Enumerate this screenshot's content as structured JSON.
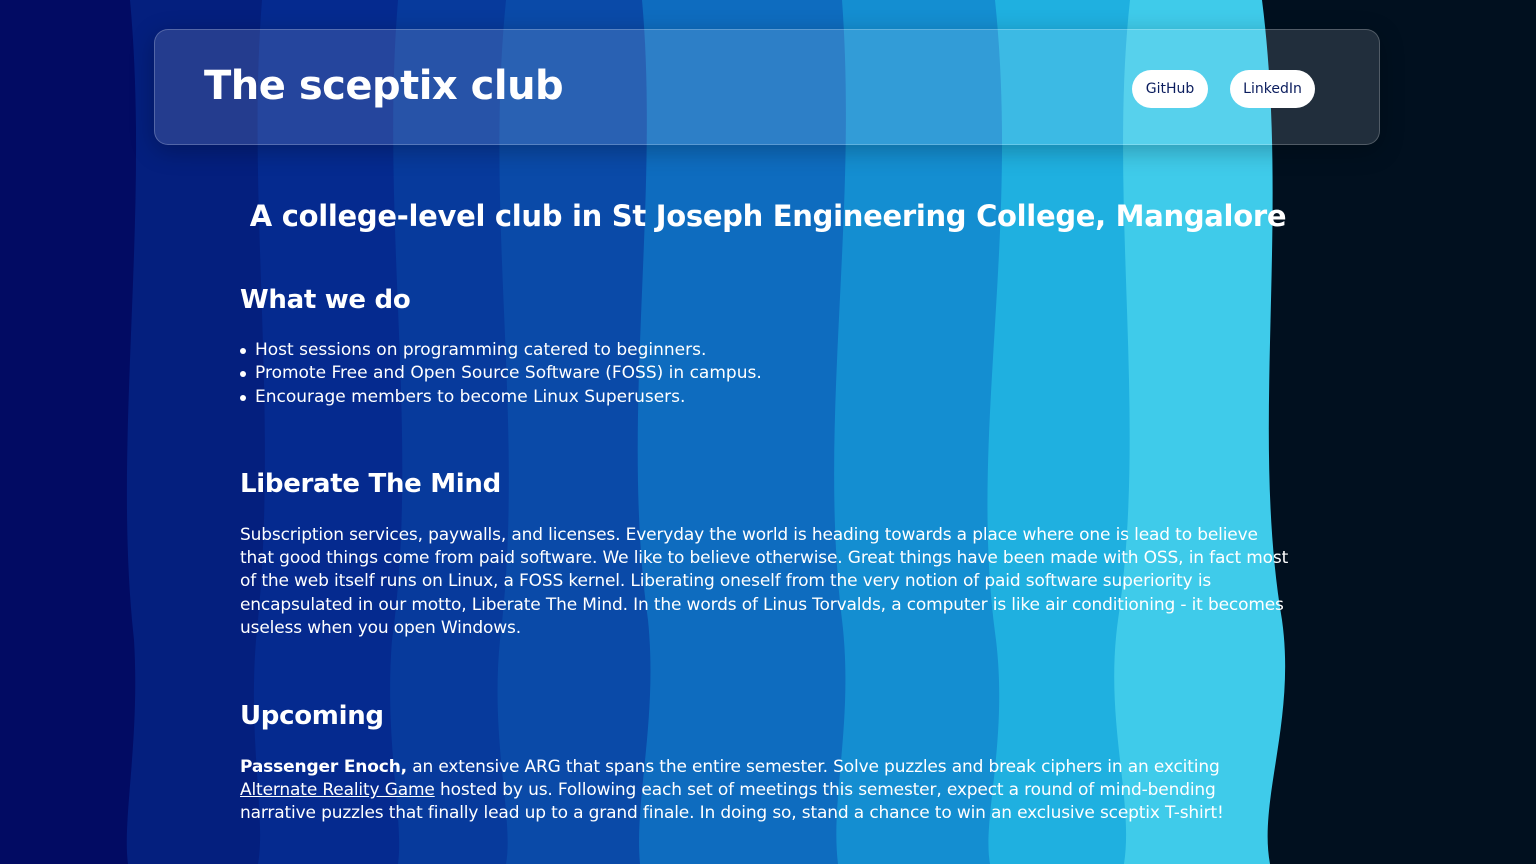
{
  "header": {
    "title": "The sceptix club",
    "links": {
      "github": "GitHub",
      "linkedin": "LinkedIn"
    }
  },
  "main": {
    "subtitle": "A college-level club in St Joseph Engineering College, Mangalore",
    "what_we_do": {
      "heading": "What we do",
      "items": [
        "Host sessions on programming catered to beginners.",
        "Promote Free and Open Source Software (FOSS) in campus.",
        "Encourage members to become Linux Superusers."
      ]
    },
    "liberate": {
      "heading": "Liberate The Mind",
      "body": "Subscription services, paywalls, and licenses. Everyday the world is heading towards a place where one is lead to believe that good things come from paid software. We like to believe otherwise. Great things have been made with OSS, in fact most of the web itself runs on Linux, a FOSS kernel. Liberating oneself from the very notion of paid software superiority is encapsulated in our motto, Liberate The Mind. In the words of Linus Torvalds, a computer is like air conditioning - it becomes useless when you open Windows."
    },
    "upcoming": {
      "heading": "Upcoming",
      "event_name": "Passenger Enoch,",
      "text_before_link": " an extensive ARG that spans the entire semester. Solve puzzles and break ciphers in an exciting ",
      "link_text": "Alternate Reality Game",
      "text_after_link": " hosted by us. Following each set of meetings this semester, expect a round of mind-bending narrative puzzles that finally lead up to a grand finale. In doing so, stand a chance to win an exclusive sceptix T-shirt!"
    }
  },
  "colors": {
    "background_dark": "#020a3a",
    "wave_bands": [
      "#020b63",
      "#052a8f",
      "#0a4aa8",
      "#0e6cbf",
      "#148ed1",
      "#1fb0e0",
      "#3fcbea",
      "#01101f"
    ],
    "pill_text": "#0b1d5e"
  }
}
